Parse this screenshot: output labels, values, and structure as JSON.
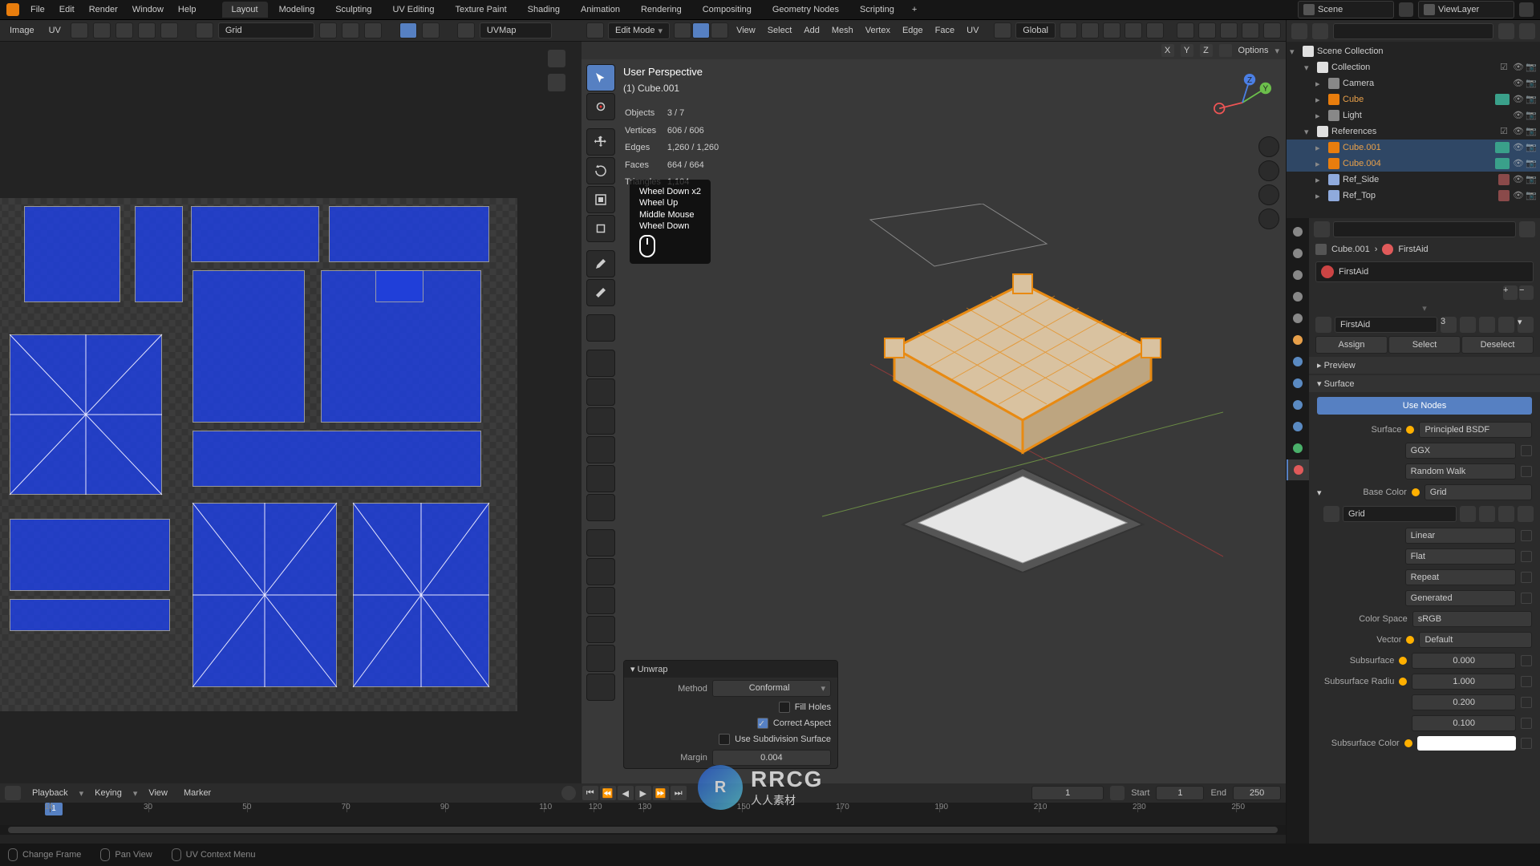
{
  "top_menu": [
    "File",
    "Edit",
    "Render",
    "Window",
    "Help"
  ],
  "workspaces": [
    "Layout",
    "Modeling",
    "Sculpting",
    "UV Editing",
    "Texture Paint",
    "Shading",
    "Animation",
    "Rendering",
    "Compositing",
    "Geometry Nodes",
    "Scripting"
  ],
  "active_workspace": 0,
  "scene_name": "Scene",
  "view_layer": "ViewLayer",
  "uv_header": {
    "menus": [
      "Image",
      "UV"
    ],
    "display": "Grid",
    "uvmap": "UVMap"
  },
  "view3d_header": {
    "mode": "Edit Mode",
    "menus": [
      "View",
      "Select",
      "Add",
      "Mesh",
      "Vertex",
      "Edge",
      "Face",
      "UV"
    ],
    "orientation": "Global"
  },
  "view3d_options": {
    "options_label": "Options",
    "axes": [
      "X",
      "Y",
      "Z"
    ]
  },
  "stats": {
    "title": "User Perspective",
    "object": "(1) Cube.001",
    "rows": [
      {
        "k": "Objects",
        "v": "3 / 7"
      },
      {
        "k": "Vertices",
        "v": "606 / 606"
      },
      {
        "k": "Edges",
        "v": "1,260 / 1,260"
      },
      {
        "k": "Faces",
        "v": "664 / 664"
      },
      {
        "k": "Triangles",
        "v": "1,104"
      }
    ]
  },
  "input_log": [
    "Wheel Down x2",
    "Wheel Up",
    "Middle Mouse",
    "Wheel Down"
  ],
  "op_panel": {
    "title": "Unwrap",
    "method_label": "Method",
    "method": "Conformal",
    "fill_holes": "Fill Holes",
    "correct_aspect": "Correct Aspect",
    "use_subsurf": "Use Subdivision Surface",
    "margin_label": "Margin",
    "margin": "0.004"
  },
  "outliner": {
    "root": "Scene Collection",
    "items": [
      {
        "name": "Collection",
        "type": "coll",
        "d": 1
      },
      {
        "name": "Camera",
        "type": "obj",
        "d": 2
      },
      {
        "name": "Cube",
        "type": "obj",
        "d": 2,
        "sel": false,
        "obj": true
      },
      {
        "name": "Light",
        "type": "obj",
        "d": 2
      },
      {
        "name": "References",
        "type": "coll",
        "d": 1
      },
      {
        "name": "Cube.001",
        "type": "obj",
        "d": 2,
        "sel": true,
        "obj": true
      },
      {
        "name": "Cube.004",
        "type": "obj",
        "d": 2,
        "sel": true,
        "obj": true
      },
      {
        "name": "Ref_Side",
        "type": "ref",
        "d": 2
      },
      {
        "name": "Ref_Top",
        "type": "ref",
        "d": 2
      }
    ]
  },
  "properties": {
    "breadcrumb": [
      "Cube.001",
      "FirstAid"
    ],
    "material": "FirstAid",
    "material2": "FirstAid",
    "material_users": "3",
    "assign": "Assign",
    "select": "Select",
    "deselect": "Deselect",
    "panels": {
      "preview": "Preview",
      "surface": "Surface"
    },
    "use_nodes": "Use Nodes",
    "surface_label": "Surface",
    "surface_value": "Principled BSDF",
    "shader_type": "GGX",
    "subsurf_method": "Random Walk",
    "base_color_label": "Base Color",
    "base_color_tex": "Grid",
    "tex_name": "Grid",
    "interp": "Linear",
    "projection": "Flat",
    "extension": "Repeat",
    "source": "Generated",
    "color_space_label": "Color Space",
    "color_space": "sRGB",
    "vector_label": "Vector",
    "vector_value": "Default",
    "subsurface_label": "Subsurface",
    "subsurface": "0.000",
    "subsurf_radius_label": "Subsurface Radiu",
    "subsurf_radius": [
      "1.000",
      "0.200",
      "0.100"
    ],
    "subsurf_color_label": "Subsurface Color"
  },
  "timeline": {
    "menus": [
      "Playback",
      "Keying",
      "View",
      "Marker"
    ],
    "current": "1",
    "cur_display": "1",
    "start_label": "Start",
    "start": "1",
    "end_label": "End",
    "end": "250",
    "ticks": [
      10,
      30,
      50,
      70,
      90,
      110,
      130,
      150,
      170,
      190,
      210,
      230,
      250
    ],
    "all_ticks": [
      10,
      30,
      50,
      70,
      90,
      110,
      120,
      130,
      150,
      170,
      190,
      210,
      230,
      250
    ]
  },
  "status": [
    {
      "name": "change-frame",
      "label": "Change Frame"
    },
    {
      "name": "pan-view",
      "label": "Pan View"
    },
    {
      "name": "uv-context-menu",
      "label": "UV Context Menu"
    }
  ],
  "watermark": {
    "big": "RRCG",
    "small": "人人素材"
  }
}
